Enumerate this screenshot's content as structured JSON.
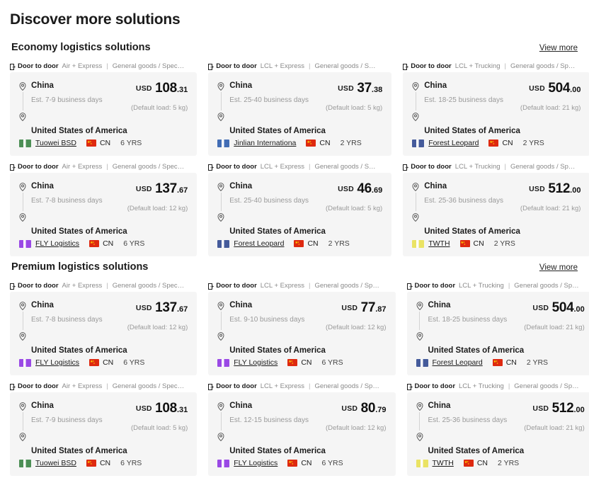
{
  "page_title": "Discover more solutions",
  "icons": {
    "door": "door-to-door-icon",
    "pin": "location-pin-icon",
    "flag": "cn-flag-icon"
  },
  "sections": [
    {
      "title": "Economy logistics solutions",
      "view_more": "View more",
      "cards": [
        {
          "door_label": "Door to door",
          "mode": "Air + Express",
          "separator": "|",
          "goods": "General goods / Speci...",
          "origin": "China",
          "eta": "Est. 7-9 business days",
          "destination": "United States of America",
          "currency": "USD",
          "price_int": "108",
          "price_dec": ".31",
          "load": "(Default load: 5 kg)",
          "supplier": "Tuowei BSD",
          "logo_color": "#2f7d3a",
          "country": "CN",
          "years": "6 YRS"
        },
        {
          "door_label": "Door to door",
          "mode": "LCL + Express",
          "separator": "|",
          "goods": "General goods / Speci...",
          "origin": "China",
          "eta": "Est. 25-40 business days",
          "destination": "United States of America",
          "currency": "USD",
          "price_int": "37",
          "price_dec": ".38",
          "load": "(Default load: 5 kg)",
          "supplier": "Jinlian Internationa",
          "logo_color": "#2255aa",
          "country": "CN",
          "years": "2 YRS"
        },
        {
          "door_label": "Door to door",
          "mode": "LCL + Trucking",
          "separator": "|",
          "goods": "General goods / Spec...",
          "origin": "China",
          "eta": "Est. 18-25 business days",
          "destination": "United States of America",
          "currency": "USD",
          "price_int": "504",
          "price_dec": ".00",
          "load": "(Default load: 21 kg)",
          "supplier": "Forest Leopard",
          "logo_color": "#26408b",
          "country": "CN",
          "years": "2 YRS"
        },
        {
          "door_label": "Door to door",
          "mode": "Air + Express",
          "separator": "|",
          "goods": "General goods / Speci...",
          "origin": "China",
          "eta": "Est. 7-8 business days",
          "destination": "United States of America",
          "currency": "USD",
          "price_int": "137",
          "price_dec": ".67",
          "load": "(Default load: 12 kg)",
          "supplier": "FLY Logistics",
          "logo_color": "#8a2be2",
          "country": "CN",
          "years": "6 YRS"
        },
        {
          "door_label": "Door to door",
          "mode": "LCL + Express",
          "separator": "|",
          "goods": "General goods / Speci...",
          "origin": "China",
          "eta": "Est. 25-40 business days",
          "destination": "United States of America",
          "currency": "USD",
          "price_int": "46",
          "price_dec": ".69",
          "load": "(Default load: 5 kg)",
          "supplier": "Forest Leopard",
          "logo_color": "#26408b",
          "country": "CN",
          "years": "2 YRS"
        },
        {
          "door_label": "Door to door",
          "mode": "LCL + Trucking",
          "separator": "|",
          "goods": "General goods / Spec...",
          "origin": "China",
          "eta": "Est. 25-36 business days",
          "destination": "United States of America",
          "currency": "USD",
          "price_int": "512",
          "price_dec": ".00",
          "load": "(Default load: 21 kg)",
          "supplier": "TWTH",
          "logo_color": "#e8e04a",
          "country": "CN",
          "years": "2 YRS"
        }
      ]
    },
    {
      "title": "Premium logistics solutions",
      "view_more": "View more",
      "cards": [
        {
          "door_label": "Door to door",
          "mode": "Air + Express",
          "separator": "|",
          "goods": "General goods / Speci...",
          "origin": "China",
          "eta": "Est. 7-8 business days",
          "destination": "United States of America",
          "currency": "USD",
          "price_int": "137",
          "price_dec": ".67",
          "load": "(Default load: 12 kg)",
          "supplier": "FLY Logistics",
          "logo_color": "#8a2be2",
          "country": "CN",
          "years": "6 YRS"
        },
        {
          "door_label": "Door to door",
          "mode": "LCL + Express",
          "separator": "|",
          "goods": "General goods / Speci...",
          "origin": "China",
          "eta": "Est. 9-10 business days",
          "destination": "United States of America",
          "currency": "USD",
          "price_int": "77",
          "price_dec": ".87",
          "load": "(Default load: 12 kg)",
          "supplier": "FLY Logistics",
          "logo_color": "#8a2be2",
          "country": "CN",
          "years": "6 YRS"
        },
        {
          "door_label": "Door to door",
          "mode": "LCL + Trucking",
          "separator": "|",
          "goods": "General goods / Spec...",
          "origin": "China",
          "eta": "Est. 18-25 business days",
          "destination": "United States of America",
          "currency": "USD",
          "price_int": "504",
          "price_dec": ".00",
          "load": "(Default load: 21 kg)",
          "supplier": "Forest Leopard",
          "logo_color": "#26408b",
          "country": "CN",
          "years": "2 YRS"
        },
        {
          "door_label": "Door to door",
          "mode": "Air + Express",
          "separator": "|",
          "goods": "General goods / Speci...",
          "origin": "China",
          "eta": "Est. 7-9 business days",
          "destination": "United States of America",
          "currency": "USD",
          "price_int": "108",
          "price_dec": ".31",
          "load": "(Default load: 5 kg)",
          "supplier": "Tuowei BSD",
          "logo_color": "#2f7d3a",
          "country": "CN",
          "years": "6 YRS"
        },
        {
          "door_label": "Door to door",
          "mode": "LCL + Express",
          "separator": "|",
          "goods": "General goods / Speci...",
          "origin": "China",
          "eta": "Est. 12-15 business days",
          "destination": "United States of America",
          "currency": "USD",
          "price_int": "80",
          "price_dec": ".79",
          "load": "(Default load: 12 kg)",
          "supplier": "FLY Logistics",
          "logo_color": "#8a2be2",
          "country": "CN",
          "years": "6 YRS"
        },
        {
          "door_label": "Door to door",
          "mode": "LCL + Trucking",
          "separator": "|",
          "goods": "General goods / Spec...",
          "origin": "China",
          "eta": "Est. 25-36 business days",
          "destination": "United States of America",
          "currency": "USD",
          "price_int": "512",
          "price_dec": ".00",
          "load": "(Default load: 21 kg)",
          "supplier": "TWTH",
          "logo_color": "#e8e04a",
          "country": "CN",
          "years": "2 YRS"
        }
      ]
    }
  ]
}
